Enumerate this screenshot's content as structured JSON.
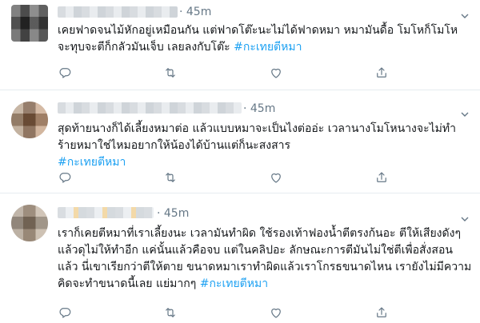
{
  "tweets": [
    {
      "time": "· 45m",
      "lines": [
        "เคยฟาดจนไม้หักอยู่เหมือนกัน แต่ฟาดโต๊ะนะไม่ได้ฟาดหมา หมามันดื้อ โมโหก็โมโห",
        "จะทุบจะตีก็กลัวมันเจ็บ เลยลงกับโต๊ะ"
      ],
      "hashtag": "#กะเทยตีหมา"
    },
    {
      "time": "· 45m",
      "lines": [
        "สุดท้ายนางก็ได้เลี้ยงหมาต่อ แล้วแบบหมาจะเป็นไงต่ออ่ะ เวลานางโมโหนางจะไม่ทำ",
        "ร้ายหมาใช่ไหมอยากให้น้องได้บ้านแต่ก็นะสงสาร"
      ],
      "hashtag": "#กะเทยตีหมา"
    },
    {
      "time": "· 45m",
      "lines": [
        "เราก็เคยตีหมาที่เราเลี้ยงนะ เวลามันทำผิด ใช้รองเท้าฟองน้ำตีตรงก้นอะ ตีให้เสียงดังๆ",
        "แล้วดุไม่ให้ทำอีก แค่นั้นแล้วคือจบ แต่ในคลิปอะ ลักษณะการตีมันไม่ใช่ตีเพื่อสั่งสอน",
        "แล้ว นี่เขาเรียกว่าตีให้ตาย ขนาดหมาเราทำผิดแล้วเราโกรธขนาดไหน เรายังไม่มีความ",
        "คิดจะทำขนาดนี้เลย แย่มากๆ"
      ],
      "hashtag": "#กะเทยตีหมา"
    }
  ],
  "icons": [
    "chevron-down-icon",
    "reply-icon",
    "retweet-icon",
    "like-icon",
    "share-icon"
  ],
  "colors": {
    "hashtag": "#1da1f2",
    "icon": "#657786",
    "divider": "#e6ecf0"
  }
}
